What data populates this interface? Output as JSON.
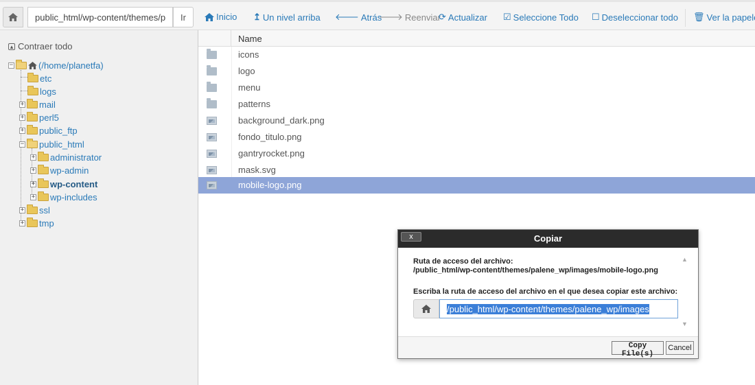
{
  "toolbar": {
    "path_value": "public_html/wp-content/themes/p",
    "go_label": "Ir",
    "buttons": {
      "home": "Inicio",
      "up": "Un nivel arriba",
      "back": "Atrás",
      "forward": "Reenviar",
      "refresh": "Actualizar",
      "select_all": "Seleccione Todo",
      "deselect_all": "Deseleccionar todo",
      "trash": "Ver la papele"
    },
    "icons": {
      "home": "house-icon",
      "up": "arrow-up-icon",
      "back": "arrow-left-icon",
      "forward": "arrow-right-icon",
      "refresh": "refresh-icon",
      "select_all": "checkbox-checked-icon",
      "deselect_all": "checkbox-empty-icon",
      "trash": "trash-icon"
    },
    "accent_color": "#2a7ab8"
  },
  "sidebar": {
    "collapse_all": "Contraer todo",
    "tree": {
      "root": "(/home/planetfa)",
      "etc": "etc",
      "logs": "logs",
      "mail": "mail",
      "perl5": "perl5",
      "public_ftp": "public_ftp",
      "public_html": "public_html",
      "administrator": "administrator",
      "wp_admin": "wp-admin",
      "wp_content": "wp-content",
      "wp_includes": "wp-includes",
      "ssl": "ssl",
      "tmp": "tmp"
    }
  },
  "filelist": {
    "header_name": "Name",
    "files": [
      {
        "name": "icons",
        "type": "dir"
      },
      {
        "name": "logo",
        "type": "dir"
      },
      {
        "name": "menu",
        "type": "dir"
      },
      {
        "name": "patterns",
        "type": "dir"
      },
      {
        "name": "background_dark.png",
        "type": "img"
      },
      {
        "name": "fondo_titulo.png",
        "type": "img"
      },
      {
        "name": "gantryrocket.png",
        "type": "img"
      },
      {
        "name": "mask.svg",
        "type": "img"
      },
      {
        "name": "mobile-logo.png",
        "type": "img",
        "selected": true
      }
    ],
    "selected_color": "#8ea5d8"
  },
  "dialog": {
    "title": "Copiar",
    "close_label": "x",
    "source_label": "Ruta de acceso del archivo:",
    "source_path": "/public_html/wp-content/themes/palene_wp/images/mobile-logo.png",
    "dest_label": "Escriba la ruta de acceso del archivo en el que desea copiar este archivo:",
    "dest_value": "/public_html/wp-content/themes/palene_wp/images",
    "copy_button": "Copy File(s)",
    "cancel_button": "Cancel"
  }
}
